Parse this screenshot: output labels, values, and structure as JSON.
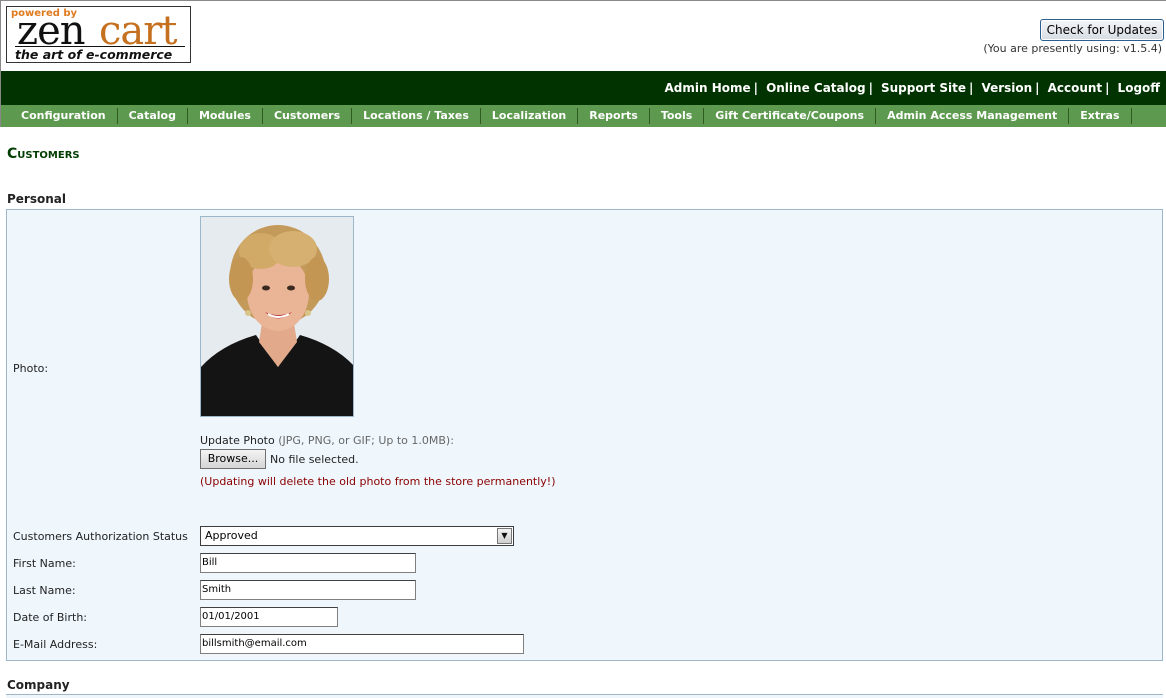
{
  "header": {
    "logo": {
      "powered_by": "powered by",
      "zen": "zen",
      "cart": "cart",
      "tagline": "the art of e-commerce"
    },
    "check_updates_label": "Check for Updates",
    "version_note": "(You are presently using: v1.5.4)"
  },
  "top_nav": {
    "items": [
      "Admin Home",
      "Online Catalog",
      "Support Site",
      "Version",
      "Account",
      "Logoff"
    ],
    "separator": "|"
  },
  "menu": {
    "items": [
      "Configuration",
      "Catalog",
      "Modules",
      "Customers",
      "Locations / Taxes",
      "Localization",
      "Reports",
      "Tools",
      "Gift Certificate/Coupons",
      "Admin Access Management",
      "Extras"
    ]
  },
  "page": {
    "title": "Customers"
  },
  "personal": {
    "heading": "Personal",
    "photo_label": "Photo:",
    "update_photo_label": "Update Photo",
    "update_photo_hint": "(JPG, PNG, or GIF; Up to 1.0MB):",
    "browse_label": "Browse...",
    "file_status": "No file selected.",
    "warning": "(Updating will delete the old photo from the store permanently!)",
    "auth_status_label": "Customers Authorization Status",
    "auth_status_value": "Approved",
    "first_name_label": "First Name:",
    "first_name_value": "Bill",
    "last_name_label": "Last Name:",
    "last_name_value": "Smith",
    "dob_label": "Date of Birth:",
    "dob_value": "01/01/2001",
    "email_label": "E-Mail Address:",
    "email_value": "billsmith@email.com"
  },
  "company": {
    "heading": "Company"
  },
  "colors": {
    "top_bar": "#013301",
    "menu_bar": "#5d9a4f",
    "panel_bg": "#eff7fd",
    "title": "#003d00",
    "warning": "#8b0000",
    "logo_accent": "#c5701e"
  }
}
